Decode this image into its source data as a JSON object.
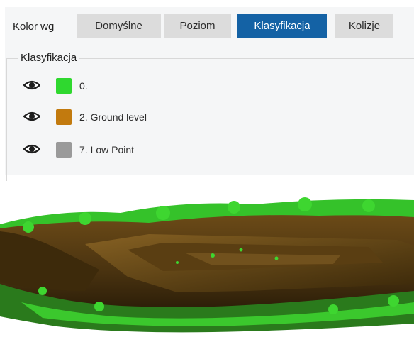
{
  "toolbar": {
    "label": "Kolor wg",
    "tabs": [
      {
        "label": "Domyślne"
      },
      {
        "label": "Poziom"
      },
      {
        "label": "Klasyfikacja"
      },
      {
        "label": "Kolizje"
      }
    ],
    "active_tab": "Klasyfikacja"
  },
  "classification": {
    "title": "Klasyfikacja",
    "items": [
      {
        "label": "0.",
        "color": "#2fd82f",
        "icon": "eye-icon"
      },
      {
        "label": "2. Ground level",
        "color": "#c27a0e",
        "icon": "eye-icon"
      },
      {
        "label": "7. Low Point",
        "color": "#9a9a9a",
        "icon": "eye-icon"
      }
    ]
  },
  "colors": {
    "accent": "#1462a5",
    "tab_bg": "#dcdcdc",
    "panel_bg": "#f5f6f7",
    "terrain": "#4a3310",
    "vegetation": "#3ed630"
  }
}
